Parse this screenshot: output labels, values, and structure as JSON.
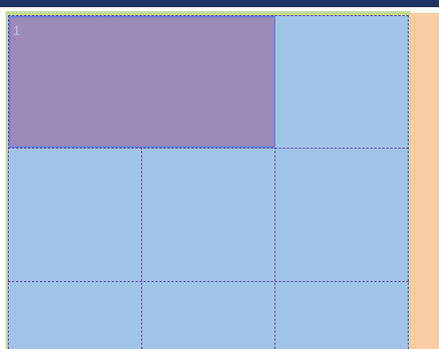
{
  "grid": {
    "columns": 3,
    "rows": 3,
    "item": {
      "label": "1",
      "column_span": 2,
      "row_span": 1
    }
  },
  "colors": {
    "top_bar": "#1d3461",
    "grid_background": "#a0c4e8",
    "grid_lines": "#5a2a8f",
    "grid_item": "#9c8bba",
    "grid_item_border": "#6b7fd6",
    "container_border": "#c5dc93",
    "side_panel": "#f8cda2"
  }
}
